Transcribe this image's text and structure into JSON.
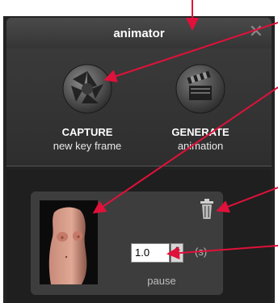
{
  "window": {
    "title": "animator",
    "close_icon": "close-icon"
  },
  "toolbar": {
    "capture": {
      "label": "CAPTURE",
      "sublabel": "new key frame",
      "icon": "camera-shutter-icon"
    },
    "generate": {
      "label": "GENERATE",
      "sublabel": "animation",
      "icon": "clapperboard-icon"
    }
  },
  "frame": {
    "thumbnail": "key-frame-thumbnail",
    "delete_icon": "trash-icon",
    "pause_value": "1.0",
    "unit": "(s)",
    "pause_label": "pause"
  },
  "colors": {
    "annotation_arrow": "#e0113a",
    "panel_bg": "#232323",
    "card_bg": "#3d3d3d"
  }
}
